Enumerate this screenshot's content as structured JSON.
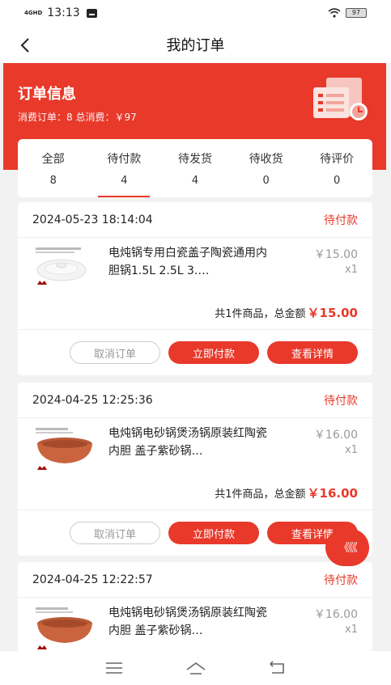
{
  "status_bar": {
    "network": "4GHD",
    "time": "13:13",
    "battery": "97"
  },
  "header": {
    "title": "我的订单"
  },
  "banner": {
    "heading": "订单信息",
    "summary": "消费订单：8 总消费：￥97"
  },
  "tabs": [
    {
      "label": "全部",
      "count": "8"
    },
    {
      "label": "待付款",
      "count": "4"
    },
    {
      "label": "待发货",
      "count": "4"
    },
    {
      "label": "待收货",
      "count": "0"
    },
    {
      "label": "待评价",
      "count": "0"
    }
  ],
  "orders": [
    {
      "date": "2024-05-23 18:14:04",
      "status": "待付款",
      "name": "电炖锅专用白瓷盖子陶瓷通用内胆锅1.5L 2.5L 3.…",
      "price": "￥15.00",
      "qty": "x1",
      "total_prefix": "共1件商品，总金额",
      "total": "￥15.00",
      "btn_cancel": "取消订单",
      "btn_pay": "立即付款",
      "btn_detail": "查看详情"
    },
    {
      "date": "2024-04-25 12:25:36",
      "status": "待付款",
      "name": "电炖锅电砂锅煲汤锅原装红陶瓷内胆 盖子紫砂锅…",
      "price": "￥16.00",
      "qty": "x1",
      "total_prefix": "共1件商品，总金额",
      "total": "￥16.00",
      "btn_cancel": "取消订单",
      "btn_pay": "立即付款",
      "btn_detail": "查看详情"
    },
    {
      "date": "2024-04-25 12:22:57",
      "status": "待付款",
      "name": "电炖锅电砂锅煲汤锅原装红陶瓷内胆 盖子紫砂锅…",
      "price": "￥16.00",
      "qty": "x1"
    }
  ],
  "fab": {
    "label": "《《《"
  },
  "colors": {
    "accent": "#e8392b",
    "background": "#f2f2f2"
  }
}
